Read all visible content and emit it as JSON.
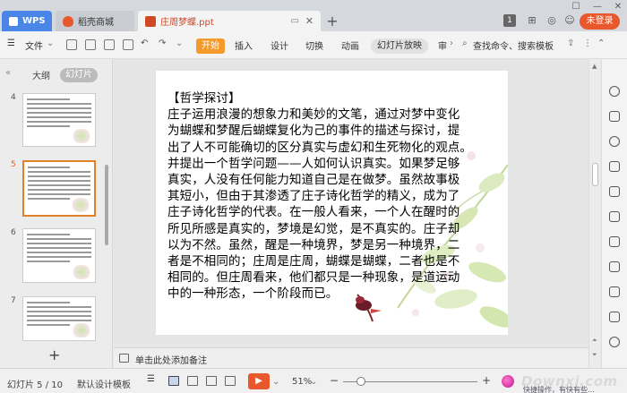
{
  "titlebar": {
    "tabs": [
      {
        "label": "WPS",
        "color": "#4a86e8"
      },
      {
        "label": "稻壳商城",
        "color": "#e8582c"
      },
      {
        "label": "庄周梦蝶.ppt",
        "color": "#d24726"
      }
    ],
    "new_tab_label": "+",
    "badge": "1",
    "login_label": "未登录",
    "window_controls": [
      "☐",
      "—",
      "□",
      "✕"
    ]
  },
  "ribbon": {
    "file_label": "文件",
    "items": [
      "开始",
      "插入",
      "设计",
      "切换",
      "动画",
      "幻灯片放映",
      "审"
    ],
    "search_label": "查找命令、搜索模板"
  },
  "left_panel": {
    "tab_outline": "大纲",
    "tab_slides": "幻灯片",
    "slide_numbers": [
      "4",
      "5",
      "6",
      "7"
    ],
    "active_slide": "5",
    "add_label": "+"
  },
  "slide": {
    "lines": [
      "【哲学探讨】",
      "庄子运用浪漫的想象力和美妙的文笔，通过对梦中变化",
      "为蝴蝶和梦醒后蝴蝶复化为己的事件的描述与探讨，提",
      "出了人不可能确切的区分真实与虚幻和生死物化的观点。",
      "并提出一个哲学问题——人如何认识真实。如果梦足够",
      "真实，人没有任何能力知道自己是在做梦。虽然故事极",
      "其短小，但由于其渗透了庄子诗化哲学的精义，成为了",
      "庄子诗化哲学的代表。在一般人看来，一个人在醒时的",
      "所见所感是真实的，梦境是幻觉，是不真实的。庄子却",
      "以为不然。虽然，醒是一种境界，梦是另一种境界，二",
      "者是不相同的；庄周是庄周，蝴蝶是蝴蝶，二者也是不",
      "相同的。但庄周看来，他们都只是一种现象，是道运动",
      "中的一种形态，一个阶段而已。"
    ]
  },
  "notes": {
    "placeholder": "单击此处添加备注"
  },
  "statusbar": {
    "slide_info": "幻灯片 5 / 10",
    "template": "默认设计模板",
    "zoom": "51%",
    "minus": "−",
    "plus": "+",
    "watermark": "Downxi.com",
    "watermark_sub": "快捷操作，有快有些..."
  },
  "colors": {
    "accent": "#e8582c",
    "start_button": "#f49a2a",
    "wps_tab": "#4a86e8"
  }
}
